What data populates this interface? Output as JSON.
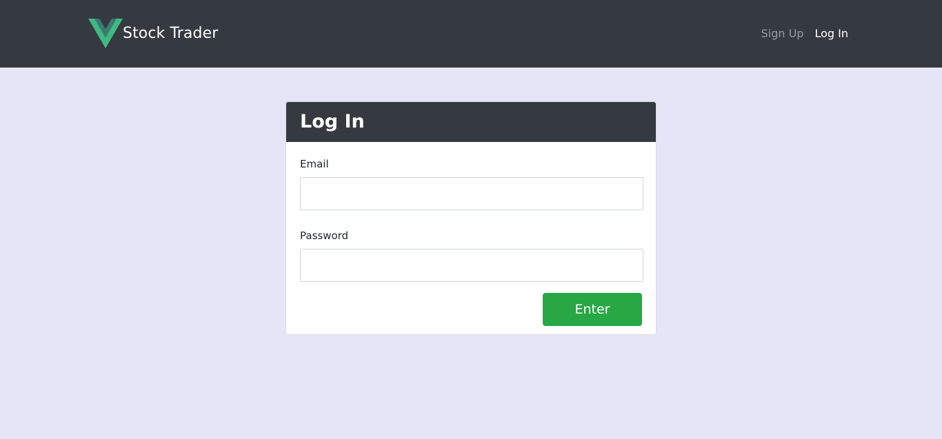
{
  "navbar": {
    "brand_name": "Stock Trader",
    "logo_icon": "vue-logo-icon",
    "links": [
      {
        "label": "Sign Up",
        "state": "inactive"
      },
      {
        "label": "Log In",
        "state": "active"
      }
    ]
  },
  "login_card": {
    "title": "Log In",
    "email": {
      "label": "Email",
      "value": "",
      "placeholder": ""
    },
    "password": {
      "label": "Password",
      "value": "",
      "placeholder": ""
    },
    "submit_label": "Enter"
  },
  "colors": {
    "navbar_bg": "#343a40",
    "page_bg": "#e5e5f7",
    "logo_green": "#41b883",
    "logo_dark": "#35495e",
    "button_green": "#28a745"
  }
}
